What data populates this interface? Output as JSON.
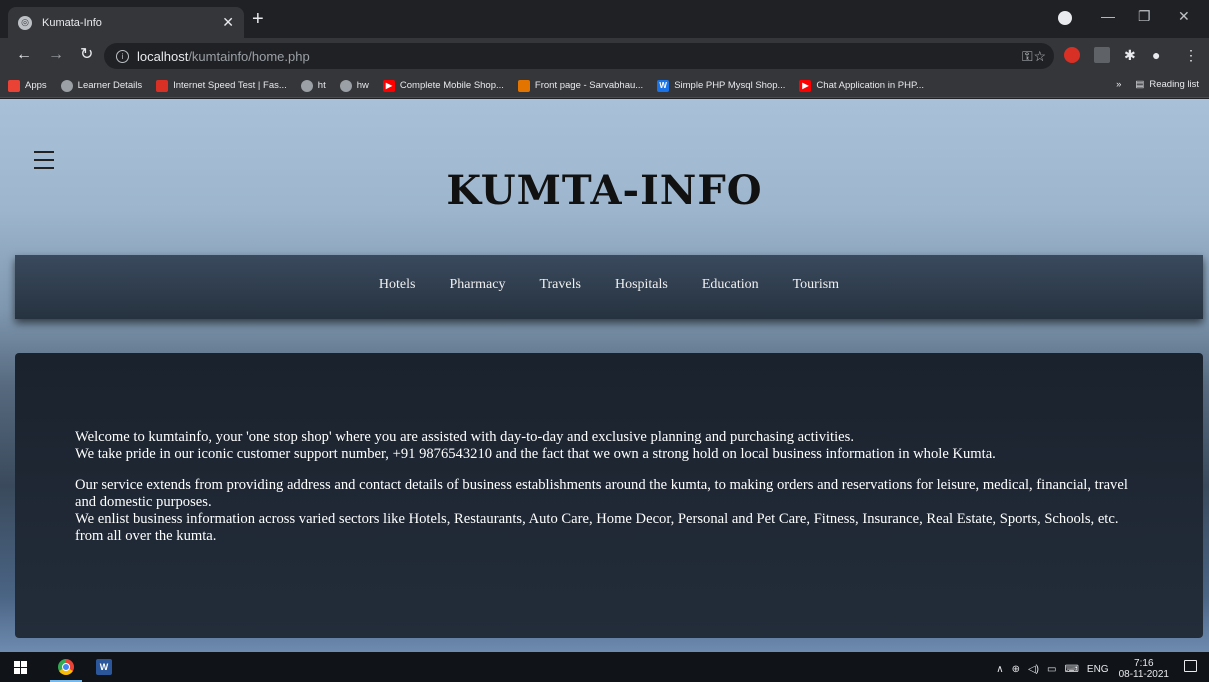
{
  "browser": {
    "tab_title": "Kumata-Info",
    "url_host": "localhost",
    "url_path": "/kumtainfo/home.php",
    "bookmarks": [
      {
        "label": "Apps",
        "icon": "apps-grid-icon",
        "color": "#ea4335"
      },
      {
        "label": "Learner Details",
        "icon": "globe-icon",
        "color": "#9aa0a6"
      },
      {
        "label": "Internet Speed Test | Fas...",
        "icon": "speedtest-icon",
        "color": "#d93025"
      },
      {
        "label": "ht",
        "icon": "globe-icon",
        "color": "#9aa0a6"
      },
      {
        "label": "hw",
        "icon": "globe-icon",
        "color": "#9aa0a6"
      },
      {
        "label": "Complete Mobile Shop...",
        "icon": "youtube-icon",
        "color": "#ff0000"
      },
      {
        "label": "Front page - Sarvabhau...",
        "icon": "site-icon",
        "color": "#e37400"
      },
      {
        "label": "Simple PHP Mysql Shop...",
        "icon": "w-icon",
        "color": "#1a73e8"
      },
      {
        "label": "Chat Application in PHP...",
        "icon": "youtube-icon",
        "color": "#ff0000"
      }
    ],
    "overflow": "»",
    "reading_list": "Reading list"
  },
  "site": {
    "title": "KUMTA-INFO",
    "nav": [
      "Hotels",
      "Pharmacy",
      "Travels",
      "Hospitals",
      "Education",
      "Tourism"
    ],
    "paragraph_1_line_1": "Welcome to kumtainfo, your 'one stop shop' where you are assisted with day-to-day and exclusive planning and purchasing activities.",
    "paragraph_1_line_2": "We take pride in our iconic customer support number, +91 9876543210 and the fact that we own a strong hold on local business information in whole Kumta.",
    "paragraph_2_line_1": "Our service extends from providing address and contact details of business establishments around the kumta, to making orders and reservations for leisure, medical, financial, travel and domestic purposes.",
    "paragraph_2_line_2": "We enlist business information across varied sectors like Hotels, Restaurants, Auto Care, Home Decor, Personal and Pet Care, Fitness, Insurance, Real Estate, Sports, Schools, etc. from all over the kumta."
  },
  "taskbar": {
    "language": "ENG",
    "time": "7:16",
    "date": "08-11-2021"
  },
  "colors": {
    "accent_blue": "#76b9ed",
    "nav_bg": "#2e3a48"
  }
}
